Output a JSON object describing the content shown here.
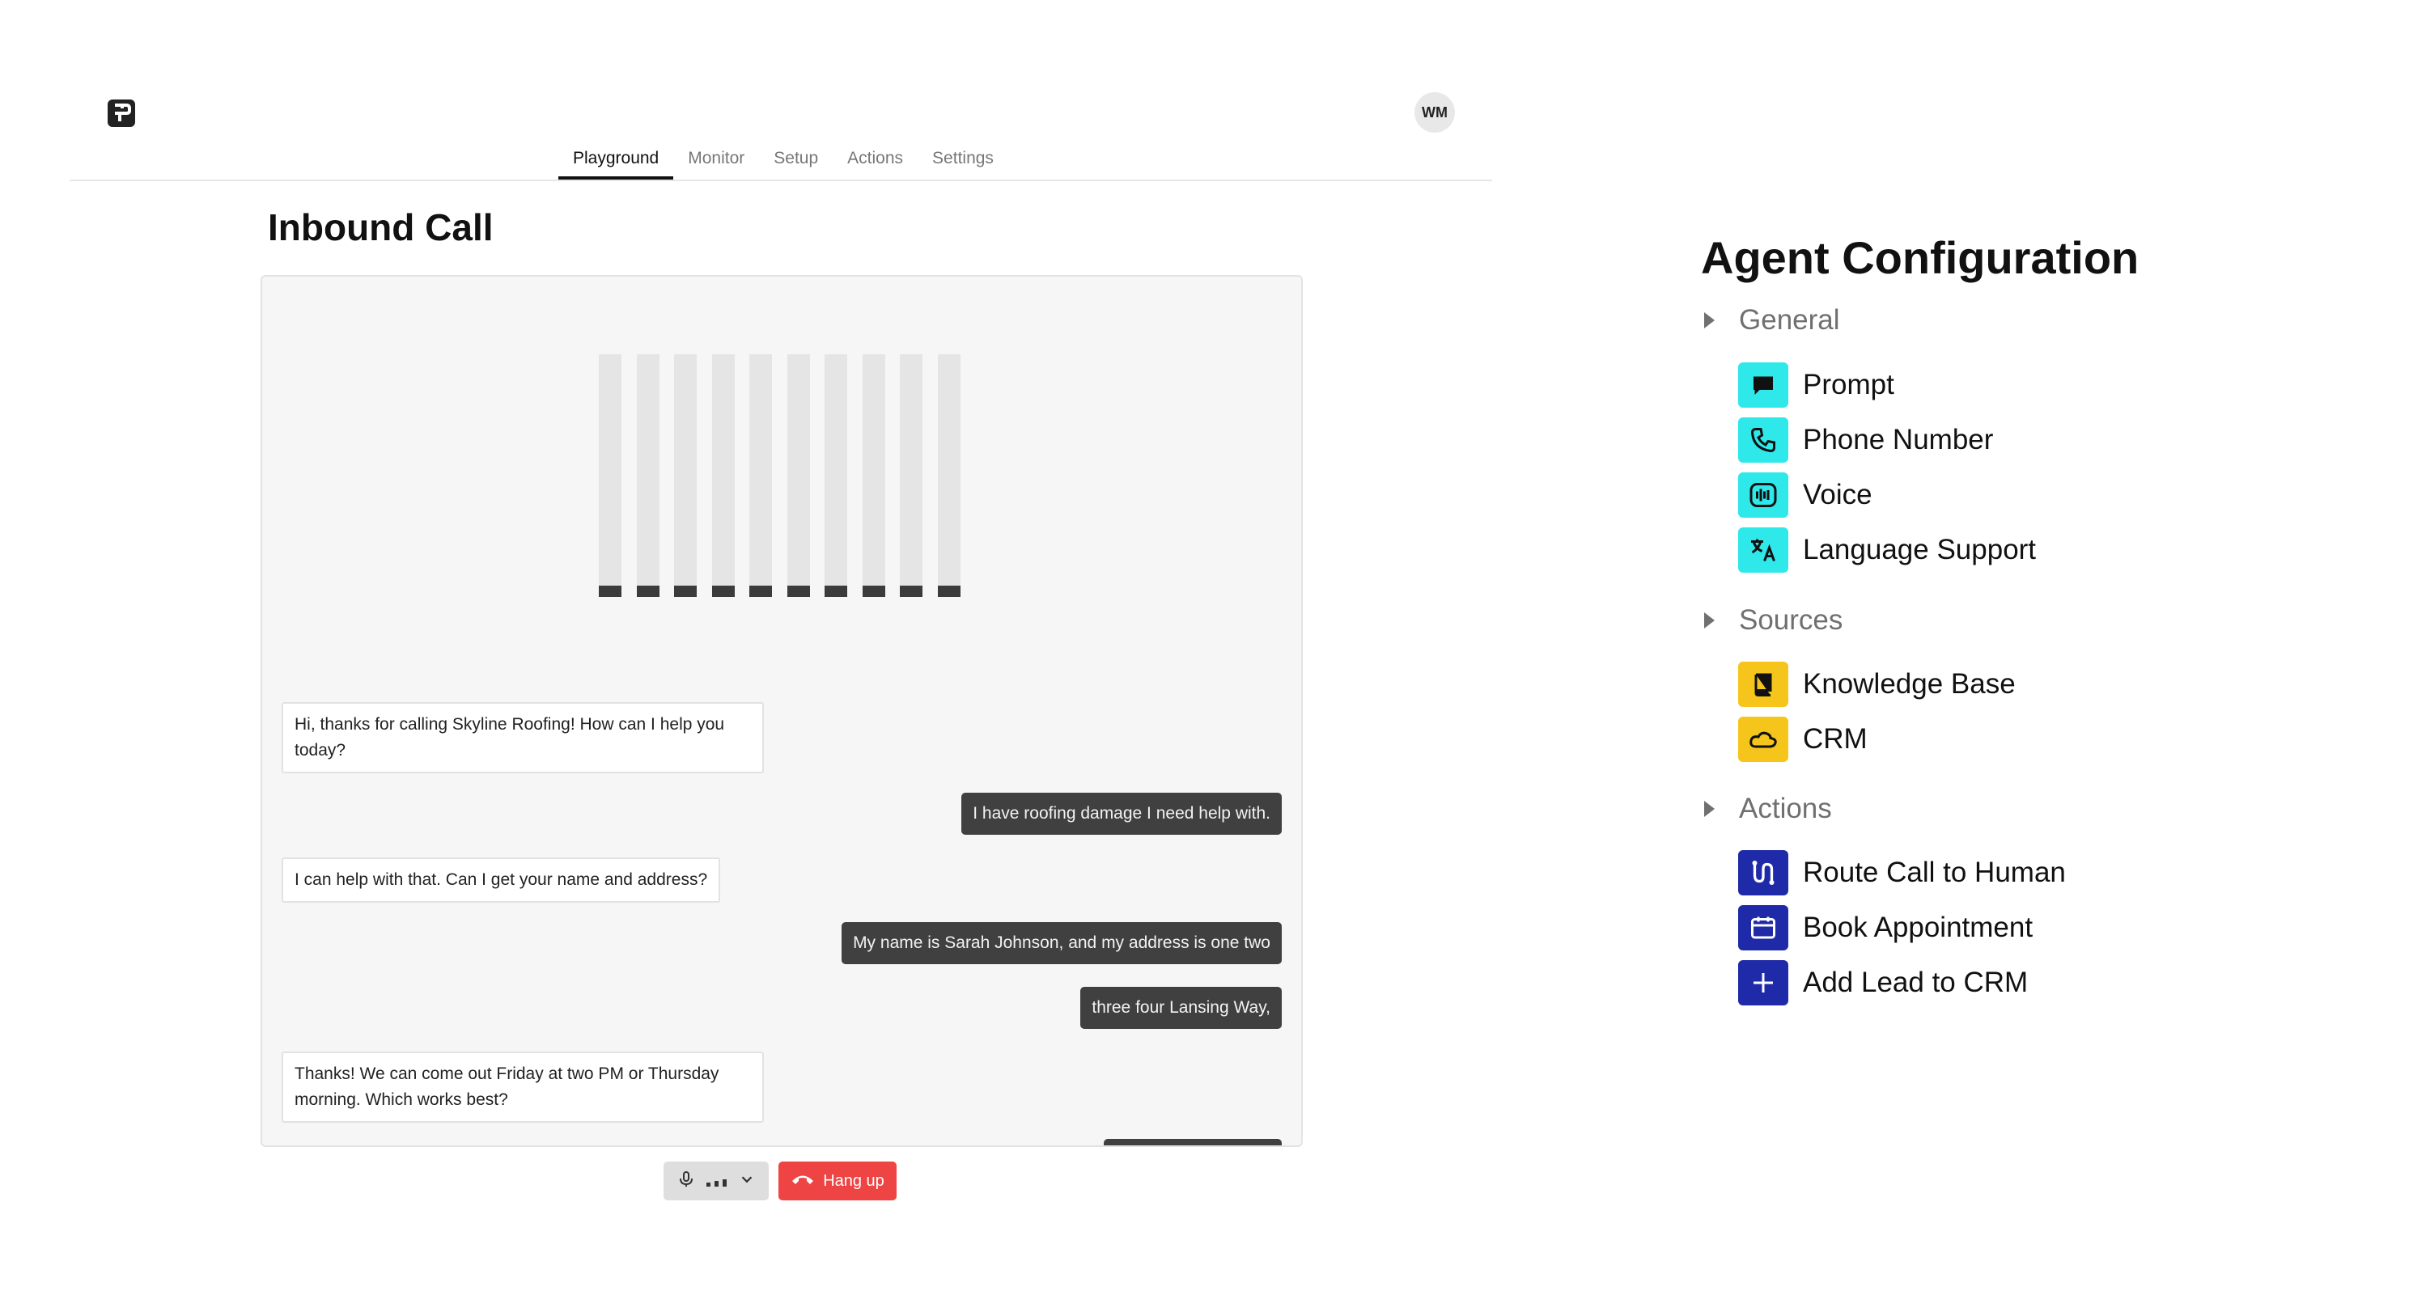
{
  "header": {
    "avatar_initials": "WM",
    "tabs": [
      {
        "label": "Playground",
        "active": true
      },
      {
        "label": "Monitor",
        "active": false
      },
      {
        "label": "Setup",
        "active": false
      },
      {
        "label": "Actions",
        "active": false
      },
      {
        "label": "Settings",
        "active": false
      }
    ]
  },
  "call": {
    "title": "Inbound Call",
    "level_meter": {
      "bar_count": 10,
      "level": 0.05
    },
    "messages": [
      {
        "role": "agent",
        "text": "Hi, thanks for calling Skyline Roofing! How can I help you today?"
      },
      {
        "role": "user",
        "text": "I have roofing damage I need help with."
      },
      {
        "role": "agent",
        "text": "I can help with that. Can I get your name and address?"
      },
      {
        "role": "user",
        "text": "My name is Sarah Johnson, and my address is one two"
      },
      {
        "role": "user",
        "text": "three four Lansing Way,"
      },
      {
        "role": "agent",
        "text": "Thanks! We can come out Friday at two PM or Thursday morning. Which works best?"
      }
    ],
    "controls": {
      "mic_icon": "microphone-icon",
      "hangup_label": "Hang up",
      "hangup_icon": "phone-hangup-icon"
    }
  },
  "config": {
    "title": "Agent Configuration",
    "sections": [
      {
        "label": "General",
        "items": [
          {
            "label": "Prompt",
            "icon": "message-icon",
            "color": "#2ee8ea"
          },
          {
            "label": "Phone Number",
            "icon": "phone-icon",
            "color": "#2ee8ea"
          },
          {
            "label": "Voice",
            "icon": "waveform-icon",
            "color": "#2ee8ea"
          },
          {
            "label": "Language Support",
            "icon": "translate-icon",
            "color": "#2ee8ea"
          }
        ]
      },
      {
        "label": "Sources",
        "items": [
          {
            "label": "Knowledge Base",
            "icon": "book-icon",
            "color": "#f5c51b"
          },
          {
            "label": "CRM",
            "icon": "cloud-icon",
            "color": "#f5c51b"
          }
        ]
      },
      {
        "label": "Actions",
        "items": [
          {
            "label": "Route Call to Human",
            "icon": "route-icon",
            "color": "#1e2aa8"
          },
          {
            "label": "Book Appointment",
            "icon": "calendar-icon",
            "color": "#1e2aa8"
          },
          {
            "label": "Add Lead to CRM",
            "icon": "plus-icon",
            "color": "#1e2aa8"
          }
        ]
      }
    ]
  }
}
